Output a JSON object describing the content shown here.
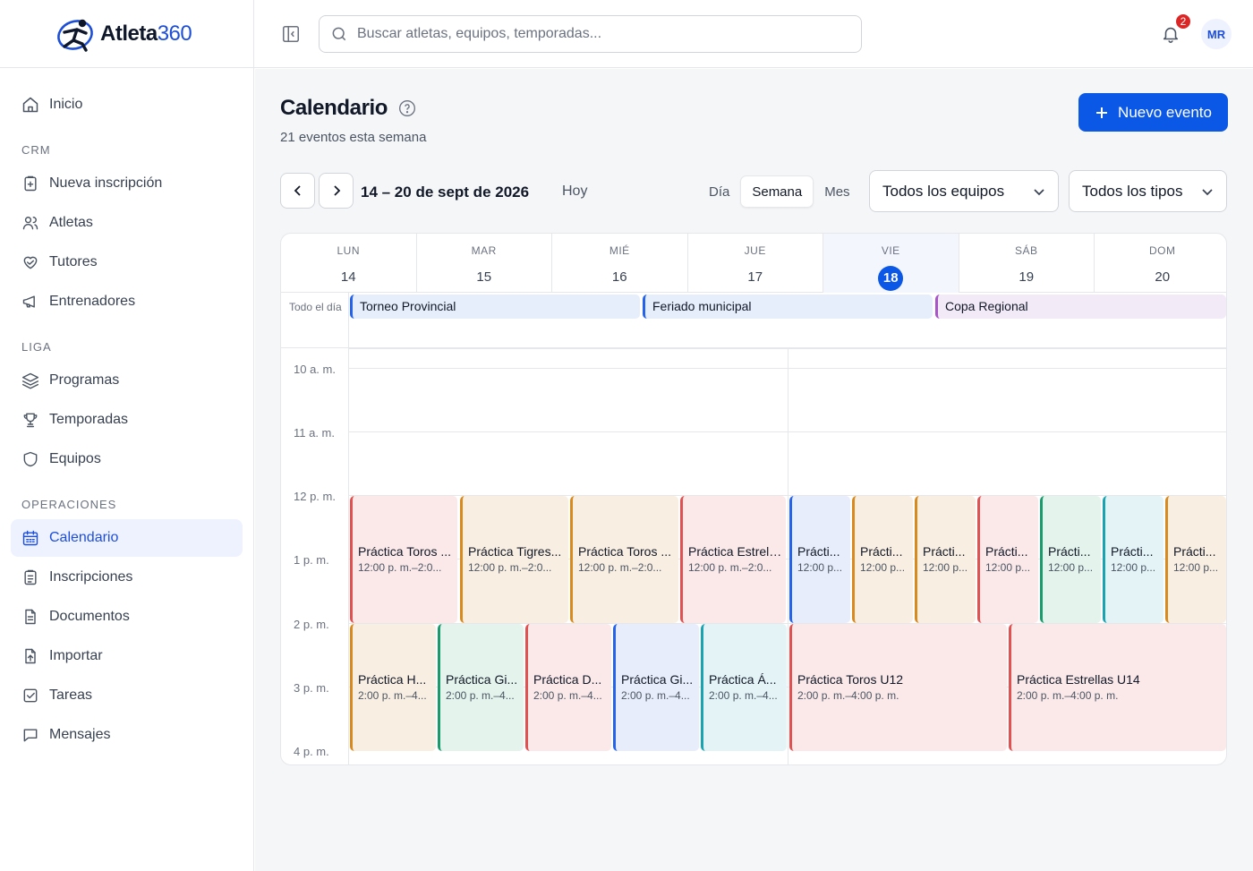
{
  "brand": {
    "name": "Atleta",
    "num": "360"
  },
  "sidebar": {
    "home": "Inicio",
    "sections": [
      {
        "title": "CRM",
        "items": [
          {
            "label": "Nueva inscripción",
            "icon": "clipboard-plus-icon"
          },
          {
            "label": "Atletas",
            "icon": "users-icon"
          },
          {
            "label": "Tutores",
            "icon": "handshake-heart-icon"
          },
          {
            "label": "Entrenadores",
            "icon": "megaphone-icon"
          }
        ]
      },
      {
        "title": "LIGA",
        "items": [
          {
            "label": "Programas",
            "icon": "layers-icon"
          },
          {
            "label": "Temporadas",
            "icon": "trophy-icon"
          },
          {
            "label": "Equipos",
            "icon": "shield-icon"
          }
        ]
      },
      {
        "title": "OPERACIONES",
        "items": [
          {
            "label": "Calendario",
            "icon": "calendar-icon",
            "active": true
          },
          {
            "label": "Inscripciones",
            "icon": "clipboard-list-icon"
          },
          {
            "label": "Documentos",
            "icon": "document-icon"
          },
          {
            "label": "Importar",
            "icon": "file-import-icon"
          },
          {
            "label": "Tareas",
            "icon": "checkbox-icon"
          },
          {
            "label": "Mensajes",
            "icon": "message-icon"
          }
        ]
      }
    ]
  },
  "topbar": {
    "search_placeholder": "Buscar atletas, equipos, temporadas...",
    "notifications": "2",
    "avatar": "MR"
  },
  "page": {
    "title": "Calendario",
    "subtitle": "21 eventos esta semana",
    "new_event": "Nuevo evento"
  },
  "toolbar": {
    "range": "14 – 20 de sept de 2026",
    "today": "Hoy",
    "views": [
      "Día",
      "Semana",
      "Mes"
    ],
    "selected_view": "Semana",
    "teams_filter": "Todos los equipos",
    "types_filter": "Todos los tipos"
  },
  "calendar": {
    "days": [
      {
        "name": "LUN",
        "date": "14"
      },
      {
        "name": "MAR",
        "date": "15"
      },
      {
        "name": "MIÉ",
        "date": "16"
      },
      {
        "name": "JUE",
        "date": "17"
      },
      {
        "name": "VIE",
        "date": "18",
        "today": true
      },
      {
        "name": "SÁB",
        "date": "19"
      },
      {
        "name": "DOM",
        "date": "20"
      }
    ],
    "all_day_label": "Todo el día",
    "all_day_events": [
      {
        "title": "Torneo Provincial",
        "color": "#2563eb",
        "bg": "#e6edfb"
      },
      {
        "title": "Feriado municipal",
        "color": "#2563eb",
        "bg": "#e6edfb"
      },
      {
        "title": "Copa Regional",
        "color": "#a855c7",
        "bg": "#f2eaf6"
      }
    ],
    "hours": [
      "10 a. m.",
      "11 a. m.",
      "12 p. m.",
      "1 p. m.",
      "2 p. m.",
      "3 p. m.",
      "4 p. m."
    ],
    "events_row1": [
      {
        "title": "Práctica Toros ...",
        "time": "12:00 p. m.–2:0...",
        "color": "#e05252",
        "bg": "#fbe9e9"
      },
      {
        "title": "Práctica Tigres...",
        "time": "12:00 p. m.–2:0...",
        "color": "#d98a1f",
        "bg": "#f9eee2"
      },
      {
        "title": "Práctica Toros ...",
        "time": "12:00 p. m.–2:0...",
        "color": "#d98a1f",
        "bg": "#f9eee2"
      },
      {
        "title": "Práctica Estrell...",
        "time": "12:00 p. m.–2:0...",
        "color": "#e05252",
        "bg": "#fbe9e9"
      },
      {
        "title": "Prácti...",
        "time": "12:00 p...",
        "color": "#2563eb",
        "bg": "#e8edfb"
      },
      {
        "title": "Prácti...",
        "time": "12:00 p...",
        "color": "#d98a1f",
        "bg": "#f9eee2"
      },
      {
        "title": "Prácti...",
        "time": "12:00 p...",
        "color": "#d98a1f",
        "bg": "#f9eee2"
      },
      {
        "title": "Prácti...",
        "time": "12:00 p...",
        "color": "#e05252",
        "bg": "#fbe9e9"
      },
      {
        "title": "Prácti...",
        "time": "12:00 p...",
        "color": "#199b6e",
        "bg": "#e4f3ec"
      },
      {
        "title": "Prácti...",
        "time": "12:00 p...",
        "color": "#1aa3b0",
        "bg": "#e3f3f6"
      },
      {
        "title": "Prácti...",
        "time": "12:00 p...",
        "color": "#d98a1f",
        "bg": "#f9eee2"
      }
    ],
    "events_row2": [
      {
        "title": "Práctica H...",
        "time": "2:00 p. m.–4...",
        "color": "#d98a1f",
        "bg": "#f9eee2"
      },
      {
        "title": "Práctica Gi...",
        "time": "2:00 p. m.–4...",
        "color": "#199b6e",
        "bg": "#e4f3ec"
      },
      {
        "title": "Práctica D...",
        "time": "2:00 p. m.–4...",
        "color": "#e05252",
        "bg": "#fbe9e9"
      },
      {
        "title": "Práctica Gi...",
        "time": "2:00 p. m.–4...",
        "color": "#2563eb",
        "bg": "#e8edfb"
      },
      {
        "title": "Práctica Á...",
        "time": "2:00 p. m.–4...",
        "color": "#1aa3b0",
        "bg": "#e3f3f6"
      },
      {
        "title": "Práctica Toros U12",
        "time": "2:00 p. m.–4:00 p. m.",
        "color": "#e05252",
        "bg": "#fbe9e9"
      },
      {
        "title": "Práctica Estrellas U14",
        "time": "2:00 p. m.–4:00 p. m.",
        "color": "#e05252",
        "bg": "#fbe9e9"
      }
    ]
  }
}
